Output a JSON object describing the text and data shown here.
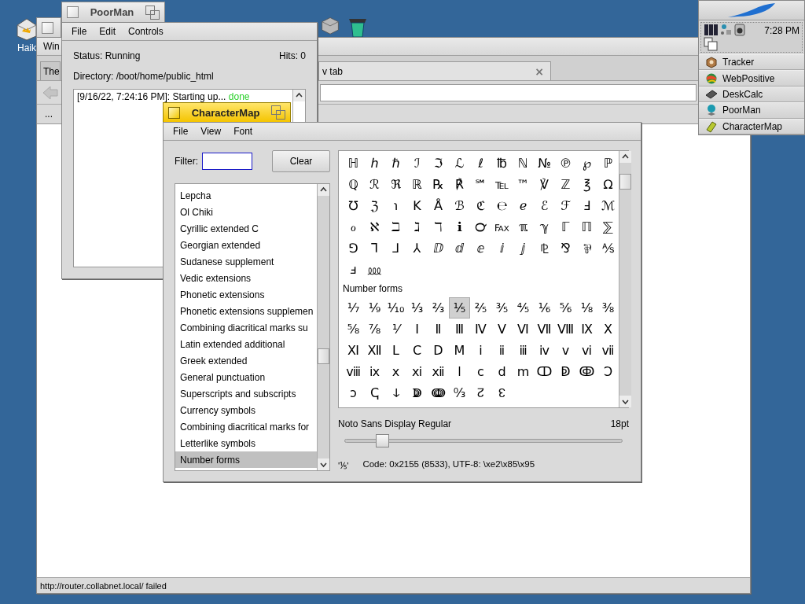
{
  "desktop": {
    "icons": [
      {
        "kind": "home",
        "label": "Haik"
      },
      {
        "kind": "drive"
      },
      {
        "kind": "trash"
      }
    ]
  },
  "browser": {
    "active": false,
    "menu": [
      "Win"
    ],
    "tabs": [
      {
        "label": "The",
        "selected": false
      },
      {
        "label": "v tab",
        "selected": true,
        "close": "×"
      }
    ],
    "overflow_button": "...",
    "status_bar": "http://router.collabnet.local/ failed"
  },
  "poorman": {
    "active": false,
    "title": "PoorMan",
    "menu": [
      "File",
      "Edit",
      "Controls"
    ],
    "status": "Status: Running",
    "hits": "Hits: 0",
    "directory": "Directory: /boot/home/public_html",
    "log": {
      "text": "[9/16/22, 7:24:16 PM]: Starting up...",
      "result": "done"
    }
  },
  "charmap": {
    "active": true,
    "title": "CharacterMap",
    "menu": [
      "File",
      "View",
      "Font"
    ],
    "filter_label": "Filter:",
    "clear_button": "Clear",
    "blocks": [
      {
        "name": "Lepcha",
        "selected": false
      },
      {
        "name": "Ol Chiki",
        "selected": false
      },
      {
        "name": "Cyrillic extended C",
        "selected": false
      },
      {
        "name": "Georgian extended",
        "selected": false
      },
      {
        "name": "Sudanese supplement",
        "selected": false
      },
      {
        "name": "Vedic extensions",
        "selected": false
      },
      {
        "name": "Phonetic extensions",
        "selected": false
      },
      {
        "name": "Phonetic extensions supplemen",
        "selected": false
      },
      {
        "name": "Combining diacritical marks su",
        "selected": false
      },
      {
        "name": "Latin extended additional",
        "selected": false
      },
      {
        "name": "Greek extended",
        "selected": false
      },
      {
        "name": "General punctuation",
        "selected": false
      },
      {
        "name": "Superscripts and subscripts",
        "selected": false
      },
      {
        "name": "Currency symbols",
        "selected": false
      },
      {
        "name": "Combining diacritical marks for",
        "selected": false
      },
      {
        "name": "Letterlike symbols",
        "selected": false
      },
      {
        "name": "Number forms",
        "selected": true
      }
    ],
    "groups": [
      {
        "rows": [
          [
            {
              "char": "ℍ",
              "selected": false
            },
            {
              "char": "ℎ",
              "selected": false
            },
            {
              "char": "ℏ",
              "selected": false
            },
            {
              "char": "ℐ",
              "selected": false
            },
            {
              "char": "ℑ",
              "selected": false
            },
            {
              "char": "ℒ",
              "selected": false
            },
            {
              "char": "ℓ",
              "selected": false
            },
            {
              "char": "℔",
              "selected": false
            },
            {
              "char": "ℕ",
              "selected": false
            },
            {
              "char": "№",
              "selected": false
            },
            {
              "char": "℗",
              "selected": false
            },
            {
              "char": "℘",
              "selected": false
            },
            {
              "char": "ℙ",
              "selected": false
            }
          ],
          [
            {
              "char": "ℚ",
              "selected": false
            },
            {
              "char": "ℛ",
              "selected": false
            },
            {
              "char": "ℜ",
              "selected": false
            },
            {
              "char": "ℝ",
              "selected": false
            },
            {
              "char": "℞",
              "selected": false
            },
            {
              "char": "℟",
              "selected": false
            },
            {
              "char": "℠",
              "selected": false
            },
            {
              "char": "℡",
              "selected": false
            },
            {
              "char": "™",
              "selected": false
            },
            {
              "char": "℣",
              "selected": false
            },
            {
              "char": "ℤ",
              "selected": false
            },
            {
              "char": "℥",
              "selected": false
            },
            {
              "char": "Ω",
              "selected": false
            }
          ],
          [
            {
              "char": "℧",
              "selected": false
            },
            {
              "char": "ℨ",
              "selected": false
            },
            {
              "char": "℩",
              "selected": false
            },
            {
              "char": "K",
              "selected": false
            },
            {
              "char": "Å",
              "selected": false
            },
            {
              "char": "ℬ",
              "selected": false
            },
            {
              "char": "ℭ",
              "selected": false
            },
            {
              "char": "℮",
              "selected": false
            },
            {
              "char": "ℯ",
              "selected": false
            },
            {
              "char": "ℰ",
              "selected": false
            },
            {
              "char": "ℱ",
              "selected": false
            },
            {
              "char": "Ⅎ",
              "selected": false
            },
            {
              "char": "ℳ",
              "selected": false
            }
          ],
          [
            {
              "char": "ℴ",
              "selected": false
            },
            {
              "char": "ℵ",
              "selected": false
            },
            {
              "char": "ℶ",
              "selected": false
            },
            {
              "char": "ℷ",
              "selected": false
            },
            {
              "char": "ℸ",
              "selected": false
            },
            {
              "char": "ℹ",
              "selected": false
            },
            {
              "char": "℺",
              "selected": false
            },
            {
              "char": "℻",
              "selected": false
            },
            {
              "char": "ℼ",
              "selected": false
            },
            {
              "char": "ℽ",
              "selected": false
            },
            {
              "char": "ℾ",
              "selected": false
            },
            {
              "char": "ℿ",
              "selected": false
            },
            {
              "char": "⅀",
              "selected": false
            }
          ],
          [
            {
              "char": "⅁",
              "selected": false
            },
            {
              "char": "⅂",
              "selected": false
            },
            {
              "char": "⅃",
              "selected": false
            },
            {
              "char": "⅄",
              "selected": false
            },
            {
              "char": "ⅅ",
              "selected": false
            },
            {
              "char": "ⅆ",
              "selected": false
            },
            {
              "char": "ⅇ",
              "selected": false
            },
            {
              "char": "ⅈ",
              "selected": false
            },
            {
              "char": "ⅉ",
              "selected": false
            },
            {
              "char": "⅊",
              "selected": false
            },
            {
              "char": "⅋",
              "selected": false
            },
            {
              "char": "⅌",
              "selected": false
            },
            {
              "char": "⅍",
              "selected": false
            }
          ],
          [
            {
              "char": "ⅎ",
              "selected": false
            },
            {
              "char": "⅏",
              "selected": false
            }
          ]
        ]
      },
      {
        "title": "Number forms",
        "rows": [
          [
            {
              "char": "⅐",
              "selected": false
            },
            {
              "char": "⅑",
              "selected": false
            },
            {
              "char": "⅒",
              "selected": false
            },
            {
              "char": "⅓",
              "selected": false
            },
            {
              "char": "⅔",
              "selected": false
            },
            {
              "char": "⅕",
              "selected": true
            },
            {
              "char": "⅖",
              "selected": false
            },
            {
              "char": "⅗",
              "selected": false
            },
            {
              "char": "⅘",
              "selected": false
            },
            {
              "char": "⅙",
              "selected": false
            },
            {
              "char": "⅚",
              "selected": false
            },
            {
              "char": "⅛",
              "selected": false
            },
            {
              "char": "⅜",
              "selected": false
            }
          ],
          [
            {
              "char": "⅝",
              "selected": false
            },
            {
              "char": "⅞",
              "selected": false
            },
            {
              "char": "⅟",
              "selected": false
            },
            {
              "char": "Ⅰ",
              "selected": false
            },
            {
              "char": "Ⅱ",
              "selected": false
            },
            {
              "char": "Ⅲ",
              "selected": false
            },
            {
              "char": "Ⅳ",
              "selected": false
            },
            {
              "char": "Ⅴ",
              "selected": false
            },
            {
              "char": "Ⅵ",
              "selected": false
            },
            {
              "char": "Ⅶ",
              "selected": false
            },
            {
              "char": "Ⅷ",
              "selected": false
            },
            {
              "char": "Ⅸ",
              "selected": false
            },
            {
              "char": "Ⅹ",
              "selected": false
            }
          ],
          [
            {
              "char": "Ⅺ",
              "selected": false
            },
            {
              "char": "Ⅻ",
              "selected": false
            },
            {
              "char": "Ⅼ",
              "selected": false
            },
            {
              "char": "Ⅽ",
              "selected": false
            },
            {
              "char": "Ⅾ",
              "selected": false
            },
            {
              "char": "Ⅿ",
              "selected": false
            },
            {
              "char": "ⅰ",
              "selected": false
            },
            {
              "char": "ⅱ",
              "selected": false
            },
            {
              "char": "ⅲ",
              "selected": false
            },
            {
              "char": "ⅳ",
              "selected": false
            },
            {
              "char": "ⅴ",
              "selected": false
            },
            {
              "char": "ⅵ",
              "selected": false
            },
            {
              "char": "ⅶ",
              "selected": false
            }
          ],
          [
            {
              "char": "ⅷ",
              "selected": false
            },
            {
              "char": "ⅸ",
              "selected": false
            },
            {
              "char": "ⅹ",
              "selected": false
            },
            {
              "char": "ⅺ",
              "selected": false
            },
            {
              "char": "ⅻ",
              "selected": false
            },
            {
              "char": "ⅼ",
              "selected": false
            },
            {
              "char": "ⅽ",
              "selected": false
            },
            {
              "char": "ⅾ",
              "selected": false
            },
            {
              "char": "ⅿ",
              "selected": false
            },
            {
              "char": "ↀ",
              "selected": false
            },
            {
              "char": "ↁ",
              "selected": false
            },
            {
              "char": "ↂ",
              "selected": false
            },
            {
              "char": "Ↄ",
              "selected": false
            }
          ],
          [
            {
              "char": "ↄ",
              "selected": false
            },
            {
              "char": "ↅ",
              "selected": false
            },
            {
              "char": "ↆ",
              "selected": false
            },
            {
              "char": "ↇ",
              "selected": false
            },
            {
              "char": "ↈ",
              "selected": false
            },
            {
              "char": "↉",
              "selected": false
            },
            {
              "char": "↊",
              "selected": false
            },
            {
              "char": "↋",
              "selected": false
            }
          ]
        ]
      }
    ],
    "font_name": "Noto Sans Display Regular",
    "font_size": "18pt",
    "size_slider": {
      "level": 0.12
    },
    "status_char": "'⅕'",
    "status_code": "Code: 0x2155 (8533), UTF-8: \\xe2\\x85\\x95"
  },
  "deskbar": {
    "clock": "7:28 PM",
    "apps": [
      {
        "kind": "tracker",
        "name": "Tracker"
      },
      {
        "kind": "browser",
        "name": "WebPositive"
      },
      {
        "kind": "calculator",
        "name": "DeskCalc"
      },
      {
        "kind": "server",
        "name": "PoorMan"
      },
      {
        "kind": "charmap",
        "name": "CharacterMap"
      }
    ]
  }
}
